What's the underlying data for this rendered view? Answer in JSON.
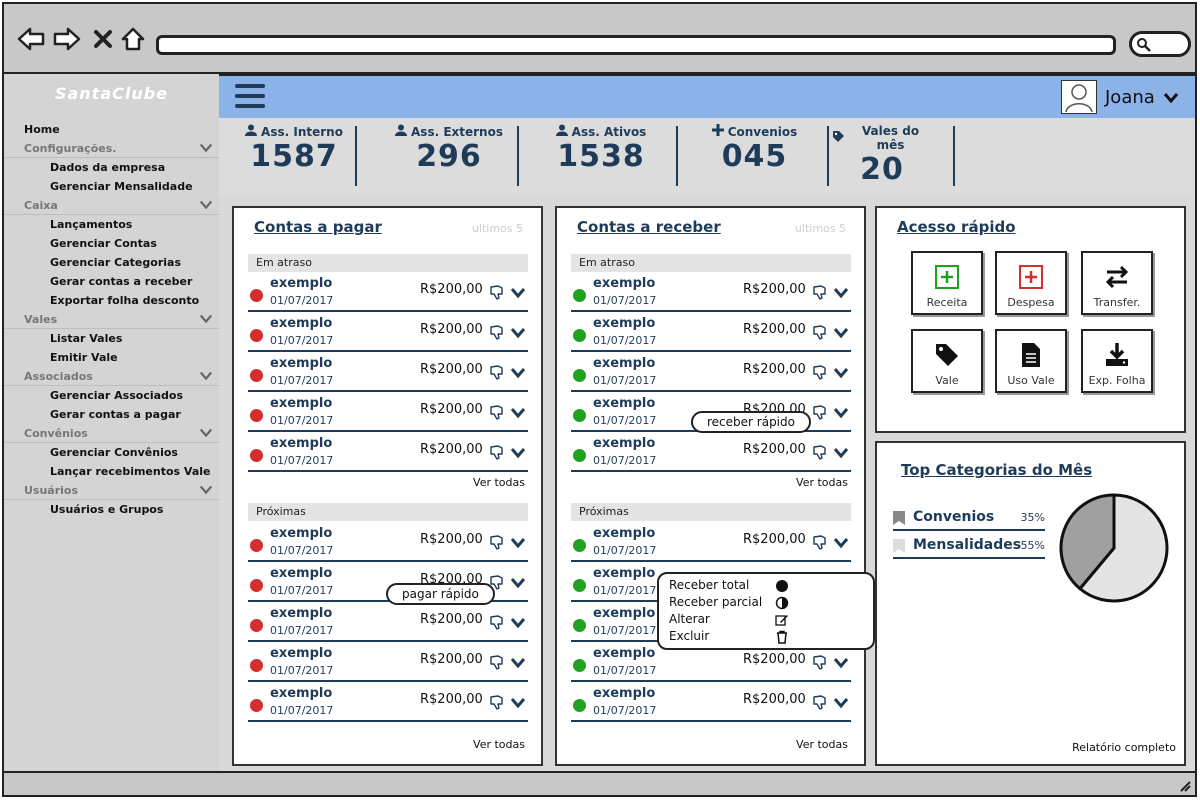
{
  "app": {
    "brand": "SantaClube"
  },
  "user": {
    "name": "Joana"
  },
  "sidebar": {
    "items": [
      {
        "type": "top",
        "label": "Home"
      },
      {
        "type": "section",
        "label": "Configurações."
      },
      {
        "type": "sub",
        "label": "Dados da empresa"
      },
      {
        "type": "sub",
        "label": "Gerenciar Mensalidade"
      },
      {
        "type": "section",
        "label": "Caixa"
      },
      {
        "type": "sub",
        "label": "Lançamentos"
      },
      {
        "type": "sub",
        "label": "Gerenciar Contas"
      },
      {
        "type": "sub",
        "label": "Gerenciar Categorias"
      },
      {
        "type": "sub",
        "label": "Gerar contas a receber"
      },
      {
        "type": "sub",
        "label": "Exportar folha desconto"
      },
      {
        "type": "section",
        "label": "Vales"
      },
      {
        "type": "sub",
        "label": "Listar Vales"
      },
      {
        "type": "sub",
        "label": "Emitir Vale"
      },
      {
        "type": "section",
        "label": "Associados"
      },
      {
        "type": "sub",
        "label": "Gerenciar Associados"
      },
      {
        "type": "sub",
        "label": "Gerar contas a pagar"
      },
      {
        "type": "section",
        "label": "Convênios"
      },
      {
        "type": "sub",
        "label": "Gerenciar Convênios"
      },
      {
        "type": "sub",
        "label": "Lançar recebimentos Vale"
      },
      {
        "type": "section",
        "label": "Usuários"
      },
      {
        "type": "sub",
        "label": "Usuários e Grupos"
      }
    ]
  },
  "stats": [
    {
      "label": "Ass. Interno",
      "value": "1587",
      "icon": "user-icon"
    },
    {
      "label": "Ass. Externos",
      "value": "296",
      "icon": "user-icon"
    },
    {
      "label": "Ass. Ativos",
      "value": "1538",
      "icon": "user-icon"
    },
    {
      "label": "Convenios",
      "value": "045",
      "icon": "plus-icon"
    },
    {
      "label": "Vales do mês",
      "value": "20",
      "icon": "tag-icon"
    }
  ],
  "pagar": {
    "title": "Contas a pagar",
    "hint": "ultimos 5",
    "overdue_label": "Em atraso",
    "upcoming_label": "Próximas",
    "see_all": "Ver todas",
    "overdue": [
      {
        "name": "exemplo",
        "date": "01/07/2017",
        "amount": "R$200,00"
      },
      {
        "name": "exemplo",
        "date": "01/07/2017",
        "amount": "R$200,00"
      },
      {
        "name": "exemplo",
        "date": "01/07/2017",
        "amount": "R$200,00"
      },
      {
        "name": "exemplo",
        "date": "01/07/2017",
        "amount": "R$200,00"
      },
      {
        "name": "exemplo",
        "date": "01/07/2017",
        "amount": "R$200,00"
      }
    ],
    "upcoming": [
      {
        "name": "exemplo",
        "date": "01/07/2017",
        "amount": "R$200,00"
      },
      {
        "name": "exemplo",
        "date": "01/07/2017",
        "amount": "R$200,00"
      },
      {
        "name": "exemplo",
        "date": "01/07/2017",
        "amount": "R$200,00"
      },
      {
        "name": "exemplo",
        "date": "01/07/2017",
        "amount": "R$200,00"
      },
      {
        "name": "exemplo",
        "date": "01/07/2017",
        "amount": "R$200,00"
      }
    ],
    "tooltip": "pagar rápido"
  },
  "receber": {
    "title": "Contas a receber",
    "hint": "ultimos 5",
    "overdue_label": "Em atraso",
    "upcoming_label": "Próximas",
    "see_all": "Ver todas",
    "overdue": [
      {
        "name": "exemplo",
        "date": "01/07/2017",
        "amount": "R$200,00"
      },
      {
        "name": "exemplo",
        "date": "01/07/2017",
        "amount": "R$200,00"
      },
      {
        "name": "exemplo",
        "date": "01/07/2017",
        "amount": "R$200,00"
      },
      {
        "name": "exemplo",
        "date": "01/07/2017",
        "amount": "R$200,00"
      },
      {
        "name": "exemplo",
        "date": "01/07/2017",
        "amount": "R$200,00"
      }
    ],
    "upcoming": [
      {
        "name": "exemplo",
        "date": "01/07/2017",
        "amount": "R$200,00"
      },
      {
        "name": "exemplo",
        "date": "01/07/2017",
        "amount": "R$200,00"
      },
      {
        "name": "exemplo",
        "date": "01/07/2017",
        "amount": "R$200,00"
      },
      {
        "name": "exemplo",
        "date": "01/07/2017",
        "amount": "R$200,00"
      },
      {
        "name": "exemplo",
        "date": "01/07/2017",
        "amount": "R$200,00"
      }
    ],
    "tooltip": "receber rápido",
    "menu": [
      {
        "label": "Receber total",
        "icon": "filled-circle-icon"
      },
      {
        "label": "Receber parcial",
        "icon": "half-circle-icon"
      },
      {
        "label": "Alterar",
        "icon": "edit-icon"
      },
      {
        "label": "Excluir",
        "icon": "trash-icon"
      }
    ]
  },
  "quick_access": {
    "title": "Acesso rápido",
    "buttons": [
      {
        "label": "Receita",
        "icon": "plus-square-icon"
      },
      {
        "label": "Despesa",
        "icon": "plus-square-icon"
      },
      {
        "label": "Transfer.",
        "icon": "exchange-icon"
      },
      {
        "label": "Vale",
        "icon": "tag-icon"
      },
      {
        "label": "Uso Vale",
        "icon": "document-icon"
      },
      {
        "label": "Exp. Folha",
        "icon": "download-icon"
      }
    ]
  },
  "top_categories": {
    "title": "Top Categorias do Mês",
    "report_link": "Relatório completo",
    "items": [
      {
        "name": "Convenios",
        "pct": "35%"
      },
      {
        "name": "Mensalidades",
        "pct": "55%"
      }
    ]
  },
  "chart_data": {
    "type": "pie",
    "categories": [
      "Convenios",
      "Mensalidades"
    ],
    "values": [
      35,
      55
    ]
  },
  "colors": {
    "accent": "#1f3b5a",
    "topbar": "#8bb3e8",
    "overdue": "#d32f2f",
    "ok": "#1fa31f",
    "pie_a": "#a0a0a0",
    "pie_b": "#e4e4e4"
  }
}
